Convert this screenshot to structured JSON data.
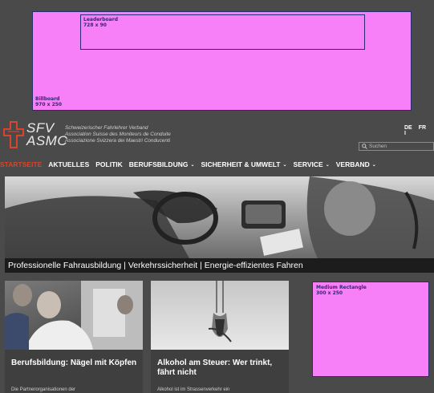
{
  "ads": {
    "billboard": {
      "name": "Billboard",
      "size": "970 x 250"
    },
    "leaderboard": {
      "name": "Leaderboard",
      "size": "728 x 90"
    },
    "medium_rectangle": {
      "name": "Medium Rectangle",
      "size": "300 x 250"
    },
    "color": "#f77ff7"
  },
  "header": {
    "logo_line1": "SFV",
    "logo_line2": "ASMC",
    "association_lines": [
      "Schweizerischer Fahrlehrer Verband",
      "Association Suisse des Moniteurs de Conduite",
      "Associazione Svizzera dei Maestri Conducenti"
    ],
    "languages": [
      "DE",
      "FR",
      "I"
    ],
    "search_placeholder": "Suchen"
  },
  "nav": {
    "items": [
      {
        "label": "STARTSEITE",
        "active": true
      },
      {
        "label": "AKTUELLES"
      },
      {
        "label": "POLITIK"
      },
      {
        "label": "BERUFSBILDUNG",
        "dropdown": true
      },
      {
        "label": "SICHERHEIT & UMWELT",
        "dropdown": true
      },
      {
        "label": "SERVICE",
        "dropdown": true
      },
      {
        "label": "VERBAND",
        "dropdown": true
      }
    ],
    "active_color": "#d6452c",
    "dropdown_glyph": "⌄"
  },
  "hero": {
    "caption": "Professionelle Fahrausbildung | Verkehrssicherheit | Energie-effizientes Fahren"
  },
  "cards": [
    {
      "title": "Berufsbildung: Nägel mit Köpfen",
      "excerpt": "Die Partnerorganisationen der"
    },
    {
      "title": "Alkohol am Steuer: Wer trinkt, fährt nicht",
      "excerpt": "Alkohol ist im Strassenverkehr ein"
    }
  ]
}
